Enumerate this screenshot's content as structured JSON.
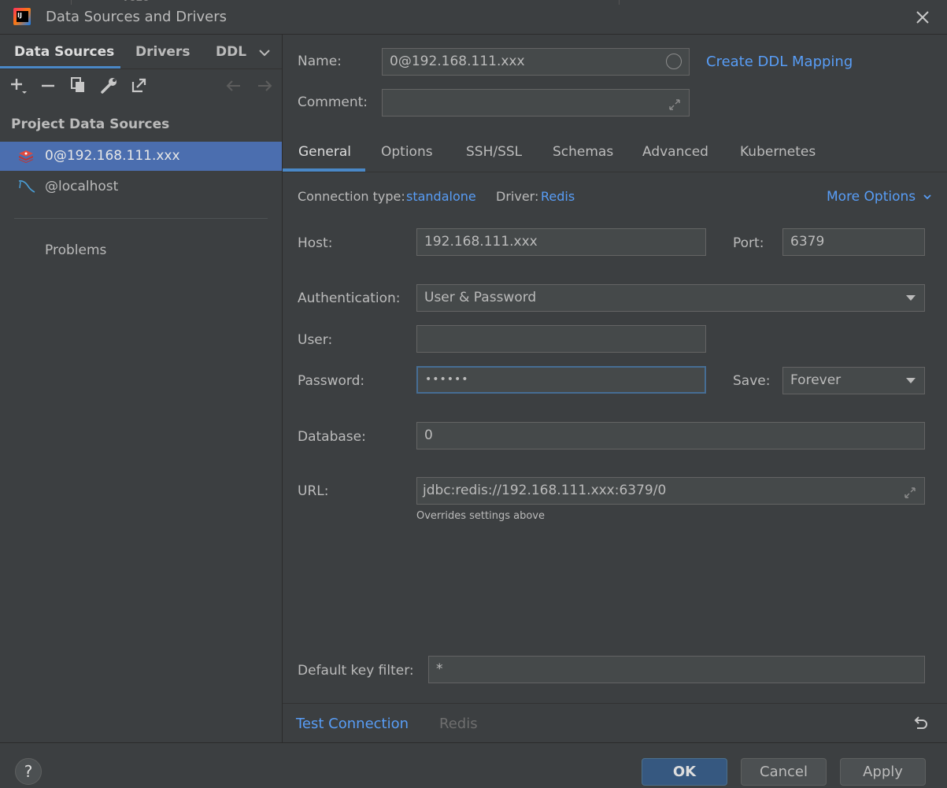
{
  "window": {
    "title": "Data Sources and Drivers",
    "app_icon_text": "IJ",
    "bg_fragment": "vozo"
  },
  "left": {
    "tabs": [
      "Data Sources",
      "Drivers",
      "DDL"
    ],
    "section_title": "Project Data Sources",
    "items": [
      {
        "label": "0@192.168.111.xxx",
        "icon": "redis-icon",
        "selected": true
      },
      {
        "label": "@localhost",
        "icon": "mysql-icon",
        "selected": false
      }
    ],
    "problems": "Problems"
  },
  "form": {
    "name_label": "Name:",
    "name_value": "0@192.168.111.xxx",
    "create_ddl": "Create DDL Mapping",
    "comment_label": "Comment:",
    "comment_value": "",
    "tabs": [
      "General",
      "Options",
      "SSH/SSL",
      "Schemas",
      "Advanced",
      "Kubernetes"
    ],
    "conn_type_label": "Connection type:",
    "conn_type_value": "standalone",
    "driver_label": "Driver:",
    "driver_value": "Redis",
    "more_options": "More Options",
    "host_label": "Host:",
    "host_value": "192.168.111.xxx",
    "port_label": "Port:",
    "port_value": "6379",
    "auth_label": "Authentication:",
    "auth_value": "User & Password",
    "user_label": "User:",
    "user_value": "",
    "password_label": "Password:",
    "password_value": "••••••",
    "save_label": "Save:",
    "save_value": "Forever",
    "database_label": "Database:",
    "database_value": "0",
    "url_label": "URL:",
    "url_value": "jdbc:redis://192.168.111.xxx:6379/0",
    "url_hint": "Overrides settings above",
    "key_filter_label": "Default key filter:",
    "key_filter_value": "*"
  },
  "bottom": {
    "test_connection": "Test Connection",
    "driver_link": "Redis",
    "help": "?",
    "ok": "OK",
    "cancel": "Cancel",
    "apply": "Apply"
  },
  "colors": {
    "accent": "#589df6",
    "selection": "#4b6eaf",
    "panel": "#3c3f41",
    "sidebar": "#3c3f41",
    "field": "#45494a"
  }
}
